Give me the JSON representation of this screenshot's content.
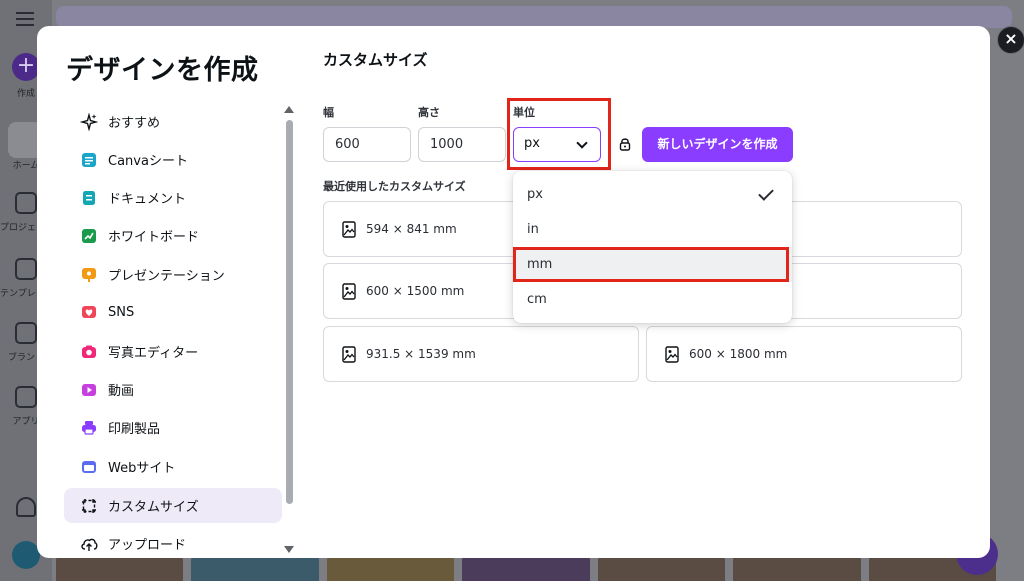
{
  "background": {
    "rail": [
      {
        "name": "rail-create",
        "label": "作成"
      },
      {
        "name": "rail-home",
        "label": "ホーム"
      },
      {
        "name": "rail-projects",
        "label": "プロジェクト"
      },
      {
        "name": "rail-templates",
        "label": "テンプレート"
      },
      {
        "name": "rail-brand",
        "label": "ブランド"
      },
      {
        "name": "rail-apps",
        "label": "アプリ"
      }
    ]
  },
  "modal": {
    "title": "デザインを作成",
    "close_label": "×"
  },
  "sidebar": {
    "items": [
      {
        "label": "おすすめ",
        "icon": "sparkle-icon",
        "color": "#0d1216"
      },
      {
        "label": "Canvaシート",
        "icon": "sheet-icon",
        "color": "#1aa6c8"
      },
      {
        "label": "ドキュメント",
        "icon": "document-icon",
        "color": "#13a6b5"
      },
      {
        "label": "ホワイトボード",
        "icon": "whiteboard-icon",
        "color": "#1a9b4b"
      },
      {
        "label": "プレゼンテーション",
        "icon": "presentation-icon",
        "color": "#f29a15"
      },
      {
        "label": "SNS",
        "icon": "heart-icon",
        "color": "#f0465a"
      },
      {
        "label": "写真エディター",
        "icon": "camera-icon",
        "color": "#f0287a"
      },
      {
        "label": "動画",
        "icon": "video-icon",
        "color": "#c640e0"
      },
      {
        "label": "印刷製品",
        "icon": "printer-icon",
        "color": "#8b3dff"
      },
      {
        "label": "Webサイト",
        "icon": "website-icon",
        "color": "#5b6cf0"
      },
      {
        "label": "カスタムサイズ",
        "icon": "custom-size-icon",
        "color": "#0d1216",
        "active": true
      },
      {
        "label": "アップロード",
        "icon": "upload-icon",
        "color": "#0d1216"
      }
    ]
  },
  "custom": {
    "section_title": "カスタムサイズ",
    "width_label": "幅",
    "width_value": "600",
    "height_label": "高さ",
    "height_value": "1000",
    "unit_label": "単位",
    "unit_value": "px",
    "create_button": "新しいデザインを作成",
    "recent_label": "最近使用したカスタムサイズ",
    "recent": [
      "594 × 841 mm",
      "",
      "600 × 1500 mm",
      "",
      "931.5 × 1539 mm",
      "600 × 1800 mm"
    ]
  },
  "unit_dropdown": {
    "options": [
      {
        "label": "px",
        "selected": true
      },
      {
        "label": "in"
      },
      {
        "label": "mm",
        "hover": true
      },
      {
        "label": "cm"
      }
    ]
  },
  "colors": {
    "accent": "#8b3dff",
    "highlight": "#e1251b"
  }
}
